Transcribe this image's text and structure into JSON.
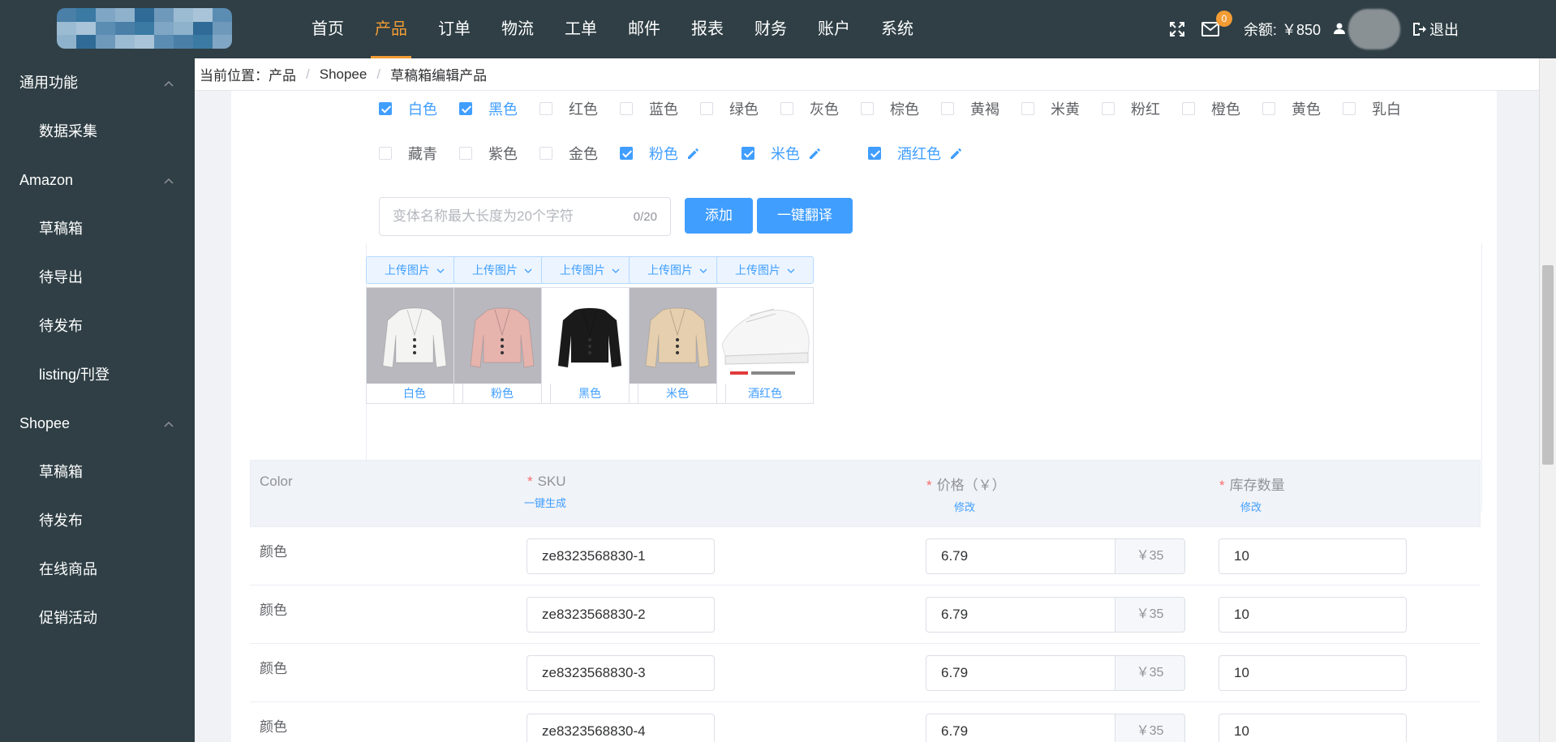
{
  "nav": [
    "首页",
    "产品",
    "订单",
    "物流",
    "工单",
    "邮件",
    "报表",
    "财务",
    "账户",
    "系统"
  ],
  "nav_active_index": 1,
  "top_right": {
    "mail_badge": "0",
    "balance_label": "余额:",
    "balance_value": "￥850",
    "logout": "退出"
  },
  "sidebar": {
    "groups": [
      {
        "label": "通用功能",
        "items": [
          "数据采集"
        ]
      },
      {
        "label": "Amazon",
        "items": [
          "草稿箱",
          "待导出",
          "待发布",
          "listing/刊登"
        ]
      },
      {
        "label": "Shopee",
        "items": [
          "草稿箱",
          "待发布",
          "在线商品",
          "促销活动"
        ]
      }
    ]
  },
  "breadcrumb": {
    "prefix": "当前位置：",
    "items": [
      "产品",
      "Shopee",
      "草稿箱编辑产品"
    ]
  },
  "colors_row1": [
    {
      "label": "白色",
      "checked": true
    },
    {
      "label": "黑色",
      "checked": true
    },
    {
      "label": "红色",
      "checked": false
    },
    {
      "label": "蓝色",
      "checked": false
    },
    {
      "label": "绿色",
      "checked": false
    },
    {
      "label": "灰色",
      "checked": false
    },
    {
      "label": "棕色",
      "checked": false
    },
    {
      "label": "黄褐",
      "checked": false
    },
    {
      "label": "米黄",
      "checked": false
    },
    {
      "label": "粉红",
      "checked": false
    },
    {
      "label": "橙色",
      "checked": false
    },
    {
      "label": "黄色",
      "checked": false
    },
    {
      "label": "乳白",
      "checked": false
    }
  ],
  "colors_row2": [
    {
      "label": "藏青",
      "checked": false
    },
    {
      "label": "紫色",
      "checked": false
    },
    {
      "label": "金色",
      "checked": false
    },
    {
      "label": "粉色",
      "checked": true,
      "editable": true
    },
    {
      "label": "米色",
      "checked": true,
      "editable": true
    },
    {
      "label": "酒红色",
      "checked": true,
      "editable": true
    }
  ],
  "variant_input": {
    "placeholder": "变体名称最大长度为20个字符",
    "counter": "0/20"
  },
  "buttons": {
    "add": "添加",
    "translate": "一键翻译"
  },
  "images": [
    {
      "upload": "上传图片",
      "caption": "白色",
      "color": "#f4f4f2"
    },
    {
      "upload": "上传图片",
      "caption": "粉色",
      "color": "#e6b3ad"
    },
    {
      "upload": "上传图片",
      "caption": "黑色",
      "color": "#1a1a1a"
    },
    {
      "upload": "上传图片",
      "caption": "米色",
      "color": "#e6cfae"
    },
    {
      "upload": "上传图片",
      "caption": "酒红色",
      "color": "#ffffff"
    }
  ],
  "table": {
    "headers": {
      "color": "Color",
      "sku": "SKU",
      "sku_action": "一键生成",
      "price": "价格（￥）",
      "price_action": "修改",
      "stock": "库存数量",
      "stock_action": "修改"
    },
    "rows": [
      {
        "color": "颜色",
        "sku": "ze8323568830-1",
        "price": "6.79",
        "price_ref": "￥35",
        "stock": "10"
      },
      {
        "color": "颜色",
        "sku": "ze8323568830-2",
        "price": "6.79",
        "price_ref": "￥35",
        "stock": "10"
      },
      {
        "color": "颜色",
        "sku": "ze8323568830-3",
        "price": "6.79",
        "price_ref": "￥35",
        "stock": "10"
      },
      {
        "color": "颜色",
        "sku": "ze8323568830-4",
        "price": "6.79",
        "price_ref": "￥35",
        "stock": "10"
      }
    ]
  }
}
